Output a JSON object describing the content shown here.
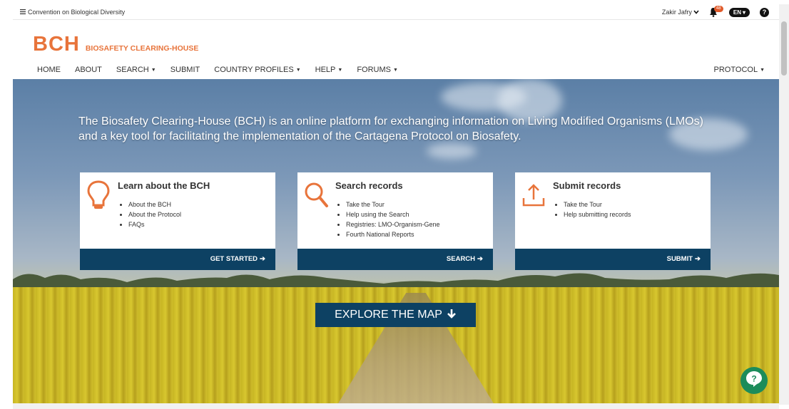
{
  "topbar": {
    "menu_label": "Convention on Biological Diversity",
    "user_name": "Zakir Jafry",
    "notification_count": "48",
    "language": "EN",
    "help_label": "?"
  },
  "logo": {
    "short": "BCH",
    "long": "BIOSAFETY CLEARING-HOUSE"
  },
  "nav": {
    "items": [
      {
        "label": "HOME",
        "dropdown": false
      },
      {
        "label": "ABOUT",
        "dropdown": false
      },
      {
        "label": "SEARCH",
        "dropdown": true
      },
      {
        "label": "SUBMIT",
        "dropdown": false
      },
      {
        "label": "COUNTRY PROFILES",
        "dropdown": true
      },
      {
        "label": "HELP",
        "dropdown": true
      },
      {
        "label": "FORUMS",
        "dropdown": true
      }
    ],
    "protocol_label": "PROTOCOL"
  },
  "hero": {
    "intro": "The Biosafety Clearing-House (BCH) is an online platform for exchanging information on Living Modified Organisms (LMOs) and a key tool for facilitating the implementation of the Cartagena Protocol on Biosafety.",
    "explore_label": "EXPLORE THE MAP"
  },
  "cards": [
    {
      "title": "Learn about the BCH",
      "icon": "lightbulb-icon",
      "links": [
        "About the BCH",
        "About the Protocol",
        "FAQs"
      ],
      "action": "GET STARTED"
    },
    {
      "title": "Search records",
      "icon": "search-icon",
      "links": [
        "Take the Tour",
        "Help using the Search",
        "Registries: LMO-Organism-Gene",
        "Fourth National Reports"
      ],
      "action": "SEARCH"
    },
    {
      "title": "Submit records",
      "icon": "upload-icon",
      "links": [
        "Take the Tour",
        "Help submitting records"
      ],
      "action": "SUBMIT"
    }
  ],
  "colors": {
    "brand_orange": "#e8743b",
    "navy": "#0d4163",
    "chat_green": "#1c8c5a"
  }
}
